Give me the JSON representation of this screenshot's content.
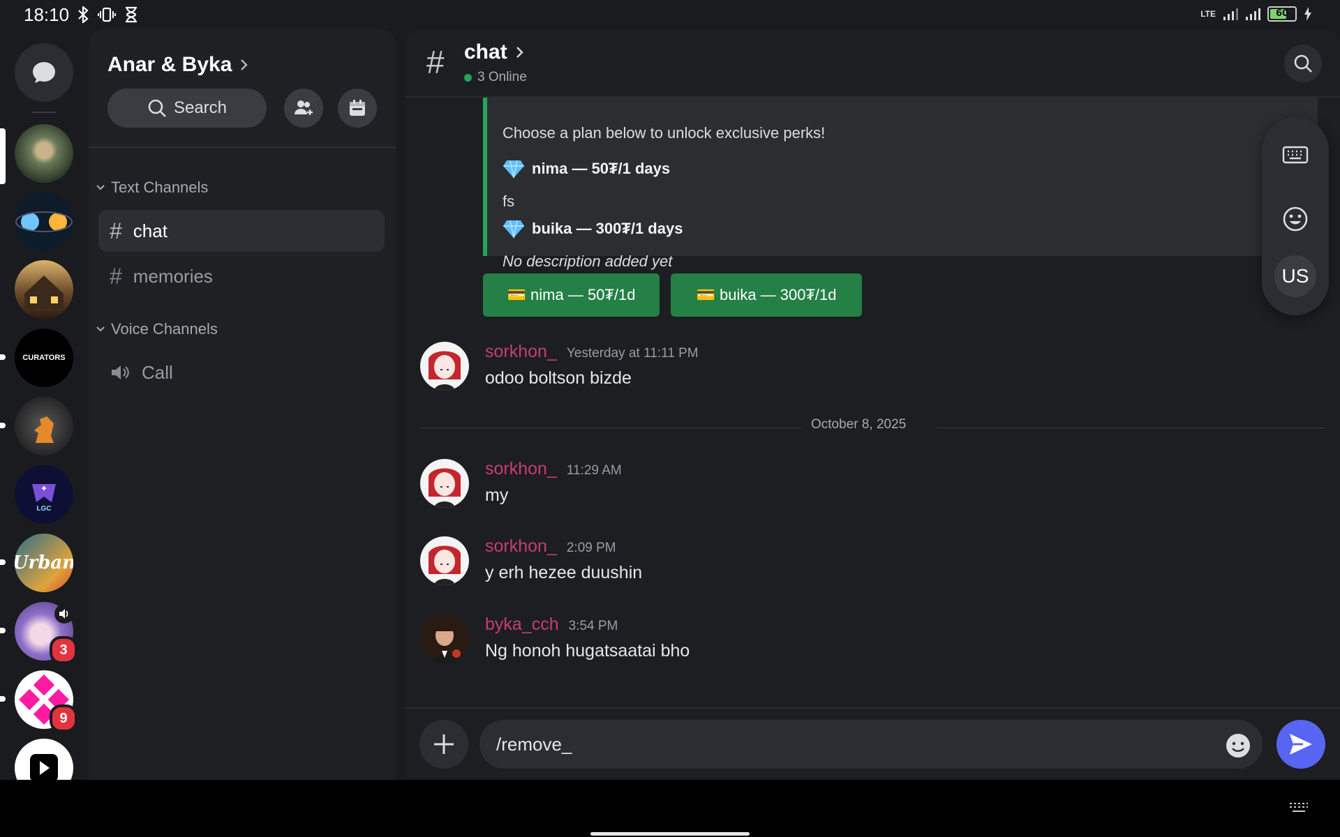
{
  "status_bar": {
    "time": "18:10",
    "left_icons": [
      "bluetooth-icon",
      "vibrate-icon",
      "hourglass-icon"
    ],
    "right_icons": [
      "lte-icon",
      "signal-icon",
      "signal-icon",
      "battery-icon",
      "charging-icon"
    ],
    "lte_label": "LTE",
    "battery_level": "60"
  },
  "server_rail": {
    "dm_icon": "chat-bubble-icon",
    "servers": [
      {
        "name": "server-gazebo",
        "colors": [
          "#6b7c5a",
          "#c9b28a"
        ],
        "badge": "",
        "selected": true
      },
      {
        "name": "server-orbs",
        "colors": [
          "#0d1b2a",
          "#e8a43a"
        ],
        "badge": ""
      },
      {
        "name": "server-house",
        "colors": [
          "#3b2a1b",
          "#d8b46a"
        ],
        "badge": ""
      },
      {
        "name": "server-curators",
        "label": "CURATORS",
        "colors": [
          "#000000",
          "#ffffff"
        ],
        "badge": ""
      },
      {
        "name": "server-knight",
        "colors": [
          "#2a2a2a",
          "#e58a2b"
        ],
        "badge": ""
      },
      {
        "name": "server-lgc",
        "label": "LGC",
        "colors": [
          "#0d1034",
          "#7b4fd8"
        ],
        "badge": ""
      },
      {
        "name": "server-urban",
        "label": "Urban",
        "colors": [
          "#2b6f8a",
          "#e0a33b"
        ],
        "badge": ""
      },
      {
        "name": "server-anime",
        "colors": [
          "#8f6fc9",
          "#d9c7ef"
        ],
        "badge": "3"
      },
      {
        "name": "server-pink-x",
        "colors": [
          "#ffffff",
          "#ff1aa3"
        ],
        "badge": "9"
      },
      {
        "name": "server-play",
        "colors": [
          "#ffffff",
          "#000000"
        ],
        "badge": ""
      }
    ]
  },
  "guild": {
    "name": "Anar & Byka",
    "search_label": "Search",
    "add_member_icon": "add-member-icon",
    "events_icon": "calendar-icon",
    "categories": [
      {
        "label": "Text Channels",
        "channels": [
          {
            "name": "chat",
            "active": true
          },
          {
            "name": "memories",
            "active": false
          }
        ]
      },
      {
        "label": "Voice Channels",
        "channels": [
          {
            "name": "Call",
            "active": false
          }
        ]
      }
    ]
  },
  "chat": {
    "title": "chat",
    "online": "3 Online",
    "embed": {
      "intro": "Choose a plan below to unlock exclusive perks!",
      "plans": [
        {
          "title": "nima — 50₮/1 days",
          "description": "fs"
        },
        {
          "title": "buika — 300₮/1 days",
          "description": "No description added yet"
        }
      ],
      "accent_color": "#23a55a"
    },
    "buttons": [
      {
        "label": "💳 nima — 50₮/1d"
      },
      {
        "label": "💳 buika — 300₮/1d"
      }
    ],
    "date_separator": "October 8, 2025",
    "messages": [
      {
        "author": "sorkhon_",
        "timestamp": "Yesterday at 11:11 PM",
        "text": "odoo boltson bizde"
      },
      {
        "author": "sorkhon_",
        "timestamp": "11:29 AM",
        "text": "my"
      },
      {
        "author": "sorkhon_",
        "timestamp": "2:09 PM",
        "text": "y erh hezee duushin"
      },
      {
        "author": "byka_cch",
        "timestamp": "3:54 PM",
        "text": "Ng honoh hugatsaatai bho"
      }
    ],
    "composer": {
      "value": "/remove_"
    },
    "username_color": "#c73c76"
  },
  "floating_toolbar": {
    "keyboard_icon": "keyboard-icon",
    "emoji_icon": "emoji-icon",
    "language": "US"
  }
}
